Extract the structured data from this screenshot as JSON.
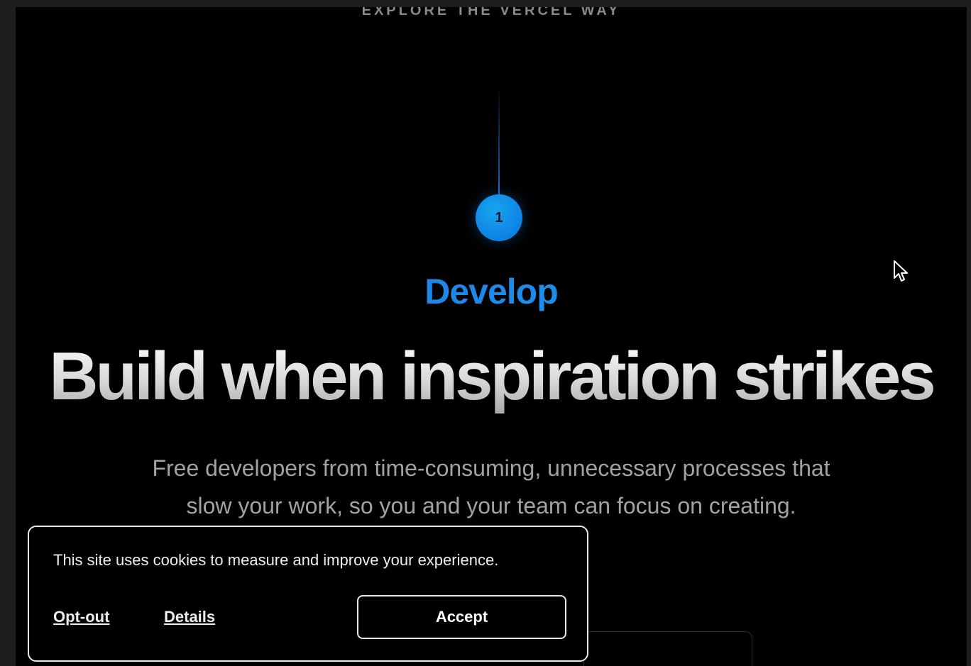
{
  "section": {
    "eyebrow": "EXPLORE THE VERCEL WAY",
    "step_number": "1",
    "step_label": "Develop",
    "headline": "Build when inspiration strikes",
    "subtext_line1": "Free developers from time-consuming, unnecessary processes that",
    "subtext_line2": "slow your work, so you and your team can focus on creating."
  },
  "cookie_banner": {
    "message": "This site uses cookies to measure and improve your experience.",
    "opt_out_label": "Opt-out",
    "details_label": "Details",
    "accept_label": "Accept"
  },
  "colors": {
    "background": "#000000",
    "accent_blue": "#1a8ff0",
    "headline": "#e6e6e6",
    "subtext": "#a2a2a2"
  },
  "icons": {
    "cursor": "mouse-pointer-icon"
  }
}
